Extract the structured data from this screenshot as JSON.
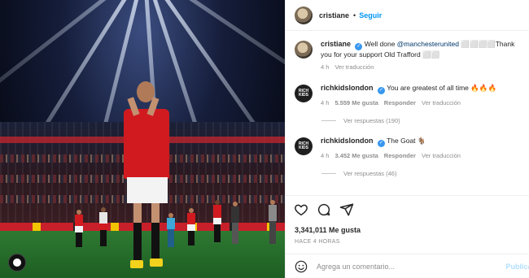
{
  "post": {
    "author": "cristiane",
    "follow_label": "Seguir",
    "dot": "•"
  },
  "comments": [
    {
      "author": "cristiane",
      "text_before": "Well done ",
      "mention": "@manchesterunited",
      "text_after": " ⬜⬜⬜⬜Thank you for your support Old Trafford ⬜⬜",
      "time": "4 h",
      "translate_label": "Ver traducción"
    },
    {
      "author": "richkidslondon",
      "text": "You are greatest of all time 🔥🔥🔥",
      "time": "4 h",
      "likes": "5.559 Me gusta",
      "reply_label": "Responder",
      "translate_label": "Ver traducción",
      "view_replies": "Ver respuestas (190)"
    },
    {
      "author": "richkidslondon",
      "text": "The Goat 🐐",
      "time": "4 h",
      "likes": "3.452 Me gusta",
      "reply_label": "Responder",
      "translate_label": "Ver traducción",
      "view_replies": "Ver respuestas (46)"
    }
  ],
  "avatar_text": "RICH KIDS",
  "likes_count": "3,341,011 Me gusta",
  "post_time": "HACE 4 HORAS",
  "add_comment": {
    "placeholder": "Agrega un comentario...",
    "publish_label": "Publicar"
  },
  "colors": {
    "accent": "#0095f6",
    "verified": "#3897f0",
    "muted": "#8e8e8e"
  },
  "icons": [
    "heart-icon",
    "comment-icon",
    "share-icon",
    "emoji-icon",
    "verified-icon"
  ]
}
